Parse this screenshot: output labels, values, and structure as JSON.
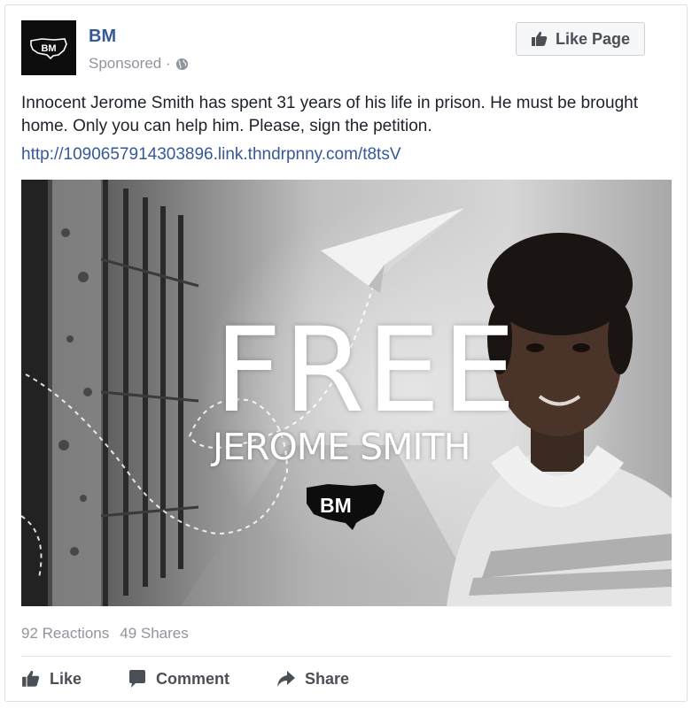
{
  "post": {
    "page_name": "BM",
    "sponsored_label": "Sponsored ·",
    "like_page_label": "Like Page",
    "text": "Innocent Jerome Smith has spent 31 years of his life in prison. He must be brought home. Only you can help him. Please, sign the petition.",
    "link": "http://1090657914303896.link.thndrpnny.com/t8tsV",
    "avatar_text": "BM"
  },
  "ad_image": {
    "headline": "FREE",
    "subheadline": "JEROME SMITH",
    "logo_text": "BM"
  },
  "stats": {
    "reactions": "92 Reactions",
    "shares": "49 Shares"
  },
  "actions": {
    "like": "Like",
    "comment": "Comment",
    "share": "Share"
  },
  "colors": {
    "link_blue": "#365899",
    "secondary_text": "#90949c",
    "action_text": "#4b4f56",
    "border": "#dddfe2"
  },
  "icons": {
    "globe": "globe-icon",
    "thumb": "thumbs-up-icon",
    "comment": "comment-icon",
    "share": "share-arrow-icon"
  }
}
